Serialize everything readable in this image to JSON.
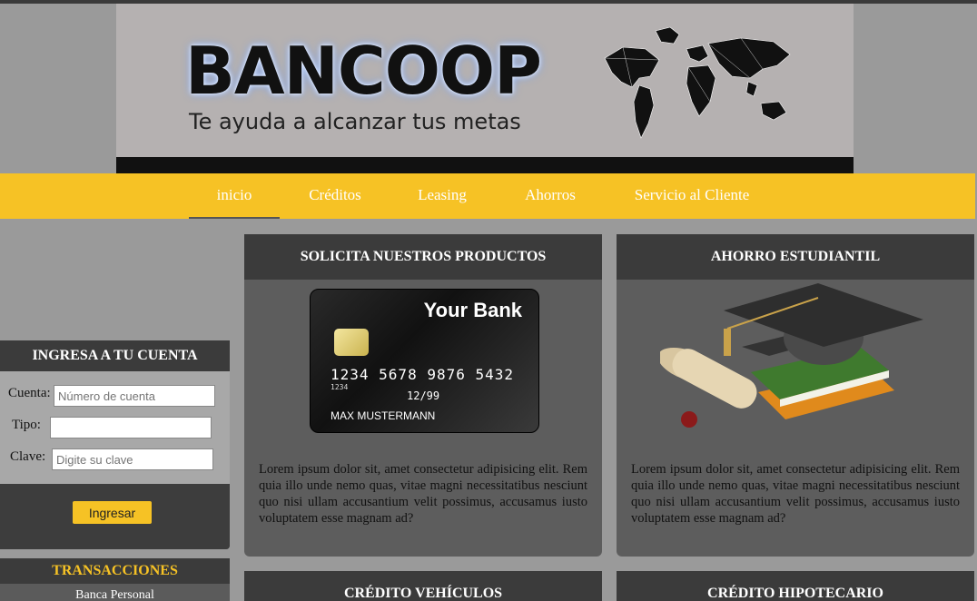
{
  "banner": {
    "brand": "BANCOOP",
    "tagline": "Te ayuda a alcanzar tus metas"
  },
  "nav": {
    "items": [
      {
        "label": "inicio",
        "active": true
      },
      {
        "label": "Créditos"
      },
      {
        "label": "Leasing"
      },
      {
        "label": "Ahorros"
      },
      {
        "label": "Servicio al Cliente"
      }
    ]
  },
  "login": {
    "title": "INGRESA A TU CUENTA",
    "cuenta_label": "Cuenta:",
    "cuenta_placeholder": "Número de cuenta",
    "tipo_label": "Tipo:",
    "tipo_value": "",
    "clave_label": "Clave:",
    "clave_placeholder": "Digite su clave",
    "submit_label": "Ingresar"
  },
  "transacciones": {
    "title": "TRANSACCIONES",
    "items": [
      "Banca Personal"
    ]
  },
  "cards": [
    {
      "title": "SOLICITA NUESTROS PRODUCTOS",
      "text": "Lorem ipsum dolor sit, amet consectetur adipisicing elit. Rem quia illo unde nemo quas, vitae magni necessitatibus nesciunt quo nisi ullam accusantium velit possimus, accusamus iusto voluptatem esse magnam ad?",
      "credit_card": {
        "bank": "Your Bank",
        "number": "1234  5678  9876  5432",
        "small_number": "1234",
        "expiry": "12/99",
        "holder": "MAX MUSTERMANN"
      }
    },
    {
      "title": "AHORRO ESTUDIANTIL",
      "text": "Lorem ipsum dolor sit, amet consectetur adipisicing elit. Rem quia illo unde nemo quas, vitae magni necessitatibus nesciunt quo nisi ullam accusantium velit possimus, accusamus iusto voluptatem esse magnam ad?"
    },
    {
      "title": "CRÉDITO VEHÍCULOS"
    },
    {
      "title": "CRÉDITO HIPOTECARIO"
    }
  ],
  "colors": {
    "accent": "#f6c225",
    "panel_dark": "#3b3b3b",
    "panel": "#5d5d5d",
    "page_bg": "#9a9a9a"
  },
  "icons": {
    "world_map": "world-map-icon",
    "graduation": "graduation-cap-icon"
  }
}
